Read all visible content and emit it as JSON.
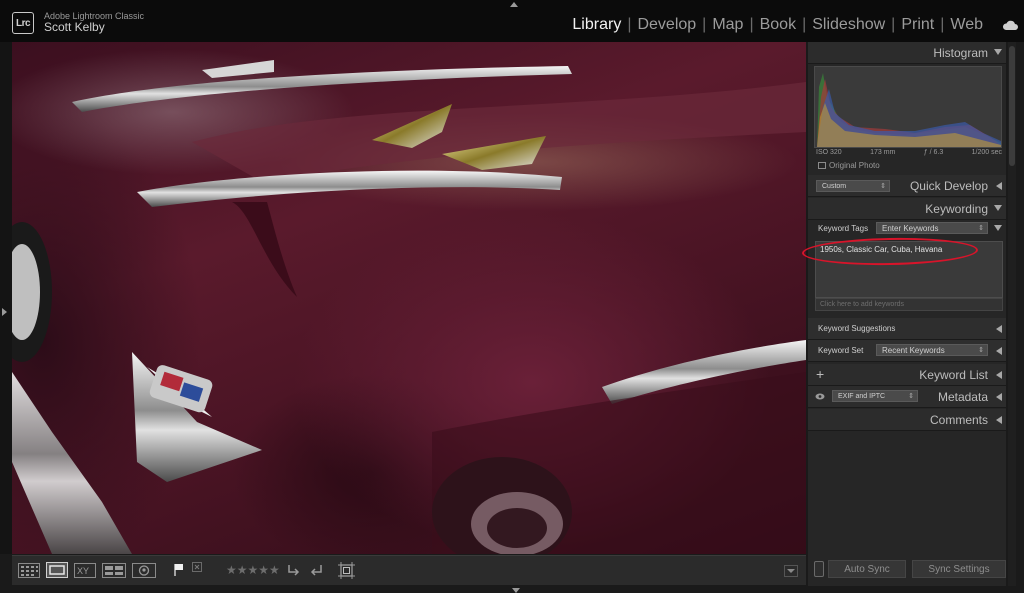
{
  "app": {
    "logo_text": "Lrc",
    "name": "Adobe Lightroom Classic",
    "user": "Scott Kelby"
  },
  "modules": [
    "Library",
    "Develop",
    "Map",
    "Book",
    "Slideshow",
    "Print",
    "Web"
  ],
  "active_module": "Library",
  "module_separator": "|",
  "panels": {
    "histogram": {
      "title": "Histogram",
      "iso": "ISO 320",
      "focal": "173 mm",
      "aperture": "ƒ / 6.3",
      "shutter": "1/200 sec",
      "original_photo": "Original Photo"
    },
    "quick_develop": {
      "title": "Quick Develop",
      "preset_value": "Custom"
    },
    "keywording": {
      "title": "Keywording",
      "tags_label": "Keyword Tags",
      "tags_mode": "Enter Keywords",
      "keywords": "1950s, Classic Car, Cuba, Havana",
      "add_placeholder": "Click here to add keywords",
      "suggestions_label": "Keyword Suggestions",
      "set_label": "Keyword Set",
      "set_value": "Recent Keywords"
    },
    "keyword_list": {
      "title": "Keyword List",
      "plus": "+"
    },
    "metadata": {
      "title": "Metadata",
      "preset_value": "EXIF and IPTC"
    },
    "comments": {
      "title": "Comments"
    }
  },
  "sync": {
    "auto_sync": "Auto Sync",
    "sync_settings": "Sync Settings"
  },
  "toolbar": {
    "stars": "★★★★★"
  },
  "icons": {
    "grid": "grid-view-icon",
    "loupe": "loupe-view-icon",
    "compare": "compare-view-icon",
    "survey": "survey-view-icon",
    "people": "people-view-icon",
    "flag": "pick-flag-icon",
    "reject": "reject-flag-icon",
    "rotate_left": "rotate-left-icon",
    "rotate_right": "rotate-right-icon",
    "crop": "crop-icon",
    "cloud": "cloud-sync-icon"
  },
  "colors": {
    "annotation": "#d8142a",
    "active_module": "#f2f2f2"
  }
}
